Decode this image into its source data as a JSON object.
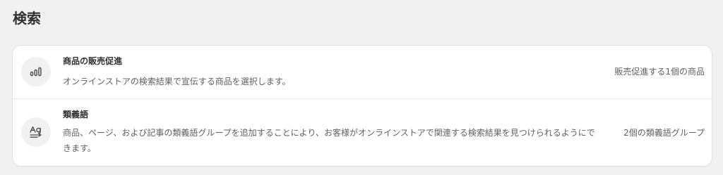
{
  "page": {
    "title": "検索"
  },
  "rows": [
    {
      "icon": "bar-chart-icon",
      "title": "商品の販売促進",
      "description": "オンラインストアの検索結果で宣伝する商品を選択します。",
      "meta": "販売促進する1個の商品"
    },
    {
      "icon": "text-synonym-icon",
      "title": "類義語",
      "description": "商品、ページ、および記事の類義語グループを追加することにより、お客様がオンラインストアで関連する検索結果を見つけられるようにできます。",
      "meta": "2個の類義語グループ"
    }
  ]
}
